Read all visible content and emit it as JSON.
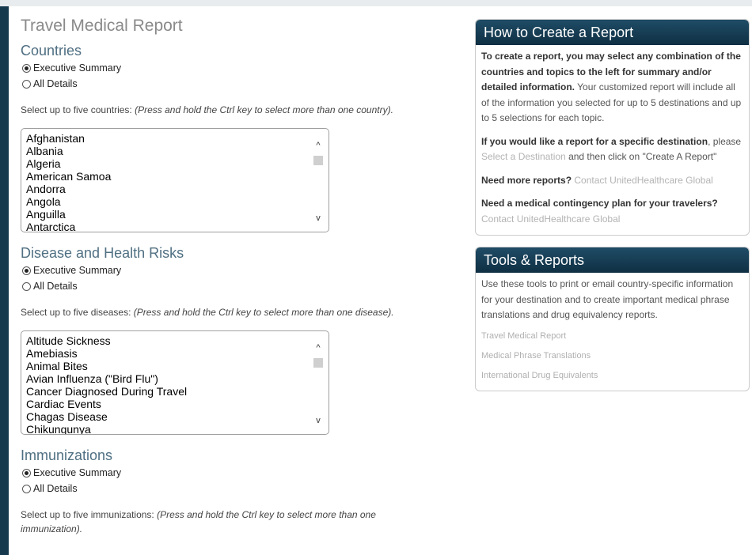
{
  "page": {
    "title": "Travel Medical Report"
  },
  "countries": {
    "heading": "Countries",
    "radio": [
      {
        "label": "Executive Summary",
        "checked": true
      },
      {
        "label": "All Details",
        "checked": false
      }
    ],
    "instruction": "Select up to five countries:",
    "instruction_note": "(Press and hold the Ctrl key to select more than one country).",
    "items": [
      "Afghanistan",
      "Albania",
      "Algeria",
      "American Samoa",
      "Andorra",
      "Angola",
      "Anguilla",
      "Antarctica"
    ]
  },
  "diseases": {
    "heading": "Disease and Health Risks",
    "radio": [
      {
        "label": "Executive Summary",
        "checked": true
      },
      {
        "label": "All Details",
        "checked": false
      }
    ],
    "instruction": "Select up to five diseases:",
    "instruction_note": "(Press and hold the Ctrl key to select more than one disease).",
    "items": [
      "Altitude Sickness",
      "Amebiasis",
      "Animal Bites",
      "Avian Influenza (\"Bird Flu\")",
      "Cancer Diagnosed During Travel",
      "Cardiac Events",
      "Chagas Disease",
      "Chikungunya"
    ]
  },
  "immunizations": {
    "heading": "Immunizations",
    "radio": [
      {
        "label": "Executive Summary",
        "checked": true
      },
      {
        "label": "All Details",
        "checked": false
      }
    ],
    "instruction": "Select up to five immunizations:",
    "instruction_note": "(Press and hold the Ctrl key to select more than one immunization)."
  },
  "how_to": {
    "heading": "How to Create a Report",
    "p1_bold": "To create a report, you may select any combination of the countries and topics to the left for summary and/or detailed information.",
    "p1_text": " Your customized report will include all of the information you selected for up to 5 destinations and up to 5 selections for each topic.",
    "p2_bold": "If you would like a report for a specific destination",
    "p2_text_a": ", please ",
    "p2_link": "Select a Destination",
    "p2_text_b": " and then click on \"Create A Report\"",
    "p3_bold": "Need more reports?",
    "p3_link": "Contact UnitedHealthcare Global",
    "p4_bold": "Need a medical contingency plan for your travelers?",
    "p4_link": "Contact UnitedHealthcare Global"
  },
  "tools": {
    "heading": "Tools & Reports",
    "description": "Use these tools to print or email country-specific information for your destination and to create important medical phrase translations and drug equivalency reports.",
    "links": [
      "Travel Medical Report",
      "Medical Phrase Translations",
      "International Drug Equivalents"
    ]
  },
  "scroll_icons": {
    "up": "^",
    "down": "v"
  }
}
